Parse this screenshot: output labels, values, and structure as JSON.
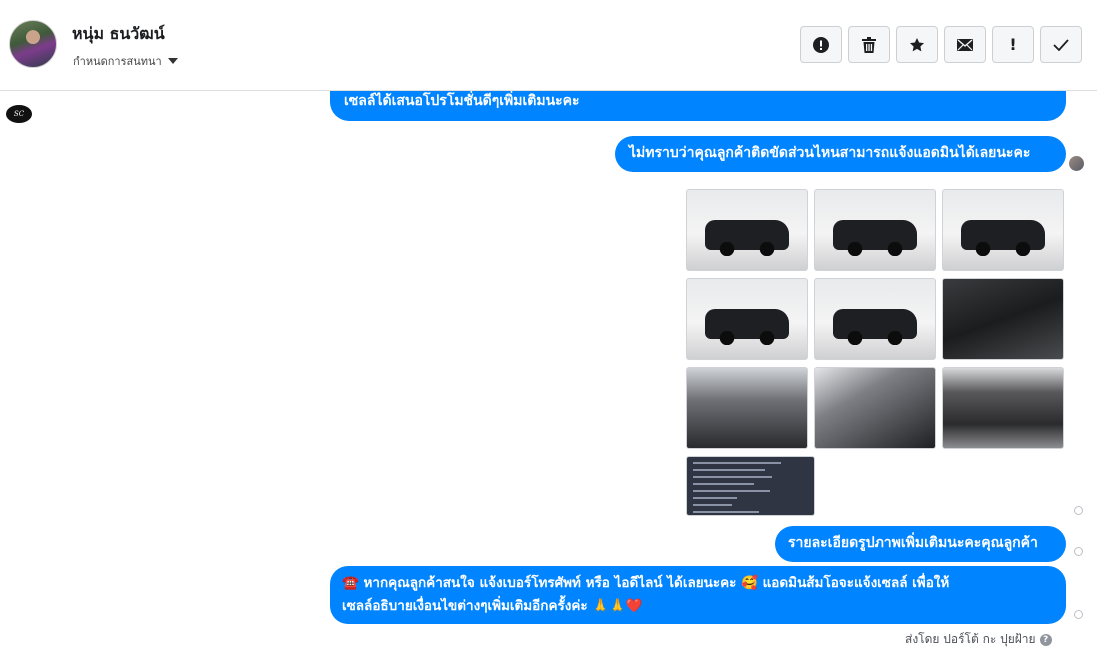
{
  "header": {
    "contact_name": "หนุ่ม ธนวัฒน์",
    "conversation_settings_label": "กำหนดการสนทนา",
    "toolbar": [
      {
        "name": "report-button",
        "icon": "alert-circle-icon",
        "glyph": "!"
      },
      {
        "name": "delete-button",
        "icon": "trash-icon",
        "glyph": ""
      },
      {
        "name": "star-button",
        "icon": "star-icon",
        "glyph": "★"
      },
      {
        "name": "mail-button",
        "icon": "envelope-icon",
        "glyph": ""
      },
      {
        "name": "mark-important-button",
        "icon": "exclamation-icon",
        "glyph": "!"
      },
      {
        "name": "mark-done-button",
        "icon": "check-icon",
        "glyph": "✓"
      }
    ]
  },
  "messages": {
    "msg1": "เซลล์ได้เสนอโปรโมชั่นดีๆเพิ่มเติมนะคะ",
    "msg2": "ไม่ทราบว่าคุณลูกค้าติดขัดส่วนไหนสามารถแจ้งแอดมินได้เลยนะคะ",
    "msg3": "รายละเอียดรูปภาพเพิ่มเติมนะคะคุณลูกค้า",
    "msg4_line1": "☎️ หากคุณลูกค้าสนใจ แจ้งเบอร์โทรศัพท์ หรือ ไอดีไลน์  ได้เลยนะคะ 🥰 แอดมินส้มโอจะแจ้งเซลล์     เพื่อให้",
    "msg4_line2": "เซลล์อธิบายเงื่อนไขต่างๆเพิ่มเติมอีกครั้งค่ะ 🙏🙏❤️"
  },
  "page_logo_text": "SC",
  "sent_by": "ส่งโดย ปอร์โต้ กะ ปุยฝ้าย",
  "photos": [
    {
      "kind": "truck-front-exterior"
    },
    {
      "kind": "truck-front-side-exterior"
    },
    {
      "kind": "truck-rear-exterior"
    },
    {
      "kind": "truck-rear-side-exterior"
    },
    {
      "kind": "truck-side-exterior"
    },
    {
      "kind": "gear-shifter-interior"
    },
    {
      "kind": "dashboard-interior"
    },
    {
      "kind": "rear-seats-interior"
    },
    {
      "kind": "engine-bay"
    },
    {
      "kind": "document-screenshot"
    }
  ],
  "colors": {
    "bubble": "#0084ff",
    "bubble_text": "#ffffff"
  }
}
